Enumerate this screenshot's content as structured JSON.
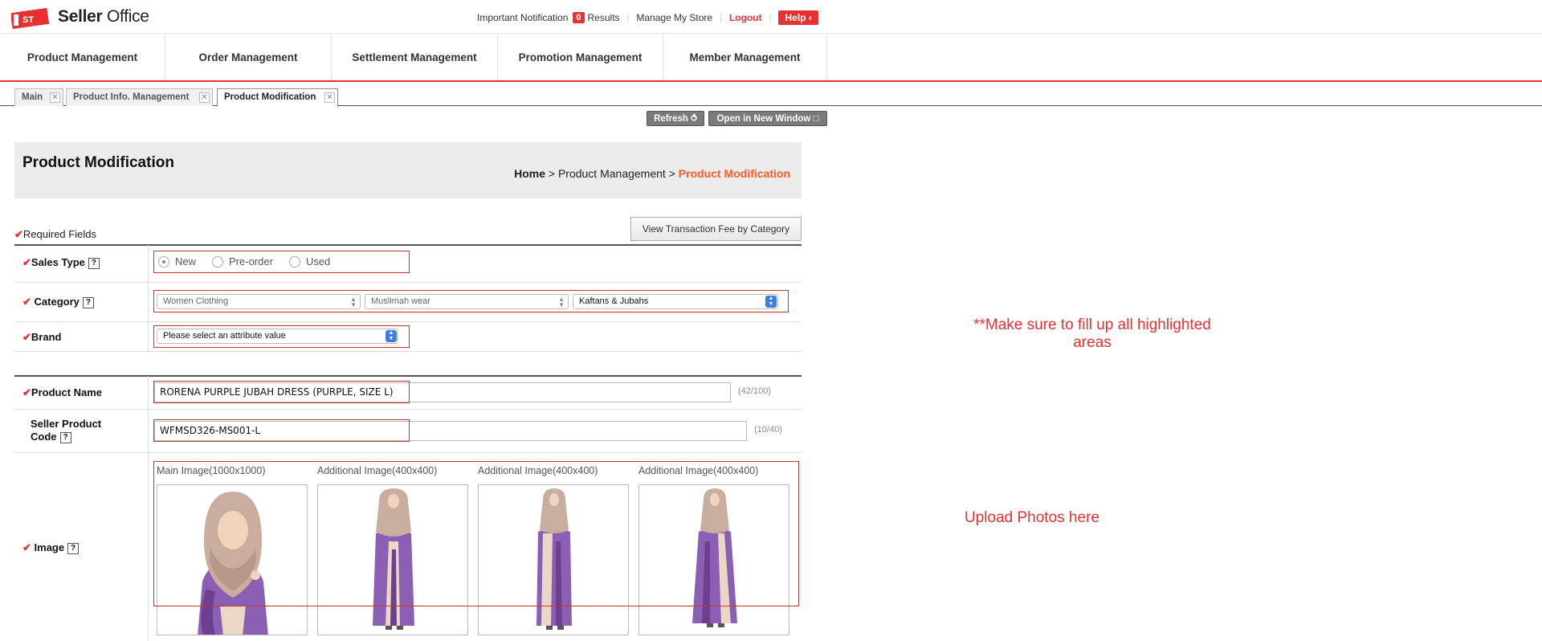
{
  "header": {
    "logo_brand": "Seller",
    "logo_suffix": "Office",
    "notification_label": "Important Notification",
    "notification_count": "0",
    "notification_suffix": "Results",
    "manage_store": "Manage My Store",
    "logout": "Logout",
    "help": "Help ‹"
  },
  "nav": {
    "items": [
      "Product Management",
      "Order Management",
      "Settlement Management",
      "Promotion Management",
      "Member Management"
    ]
  },
  "tabs": [
    "Main",
    "Product Info. Management",
    "Product Modification"
  ],
  "tools": {
    "refresh": "Refresh ⥀",
    "new_window": "Open in New Window □"
  },
  "page": {
    "title": "Product Modification",
    "breadcrumb_home": "Home",
    "breadcrumb_section": "Product Management",
    "breadcrumb_current": "Product Modification",
    "breadcrumb_sep": ">"
  },
  "form": {
    "required_note": "Required Fields",
    "fee_button": "View Transaction Fee by Category",
    "sales_type": {
      "label": "Sales Type",
      "options": [
        "New",
        "Pre-order",
        "Used"
      ],
      "selected": "New"
    },
    "category": {
      "label": "Category",
      "level1": "Women Clothing",
      "level2": "Muslimah wear",
      "level3": "Kaftans & Jubahs"
    },
    "brand": {
      "label": "Brand",
      "value": "Please select an attribute value"
    },
    "product_name": {
      "label": "Product Name",
      "value": "RORENA PURPLE JUBAH DRESS (PURPLE, SIZE L)",
      "count": "(42/100)"
    },
    "seller_code": {
      "label_line1": "Seller Product",
      "label_line2": "Code",
      "value": "WFMSD326-MS001-L",
      "count": "(10/40)"
    },
    "image": {
      "label": "Image",
      "captions": [
        "Main Image(1000x1000)",
        "Additional Image(400x400)",
        "Additional Image(400x400)",
        "Additional Image(400x400)"
      ]
    }
  },
  "annotations": {
    "note1": "**Make sure to fill up all highlighted areas",
    "note2": "Upload Photos here"
  },
  "colors": {
    "accent_red": "#e83030",
    "breadcrumb_orange": "#ff5a1f",
    "highlight_border": "#c0392b",
    "product_purple": "#8a5fb4"
  }
}
